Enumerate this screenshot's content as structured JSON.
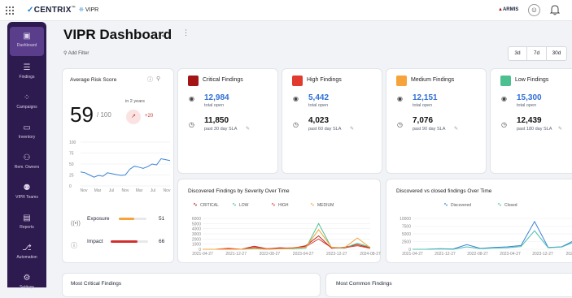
{
  "app": {
    "brand": "CENTRIX",
    "product": "VIPR",
    "partner_logo": "ARMIS"
  },
  "sidebar": {
    "items": [
      {
        "label": "Dashboard",
        "icon": "dashboard-icon",
        "active": true
      },
      {
        "label": "Findings",
        "icon": "list-icon"
      },
      {
        "label": "Campaigns",
        "icon": "campaigns-icon"
      },
      {
        "label": "Inventory",
        "icon": "monitor-icon"
      },
      {
        "label": "Rem. Owners",
        "icon": "users-icon"
      },
      {
        "label": "VIPR Teams",
        "icon": "teams-icon"
      },
      {
        "label": "Reports",
        "icon": "report-icon"
      },
      {
        "label": "Automation",
        "icon": "automation-icon"
      },
      {
        "label": "Settings",
        "icon": "settings-icon"
      }
    ]
  },
  "header": {
    "title": "VIPR Dashboard",
    "add_filter": "Add Filter",
    "ranges": [
      "3d",
      "7d",
      "30d"
    ]
  },
  "risk": {
    "title": "Average Risk Score",
    "score": "59",
    "max": "/ 100",
    "period": "in 2 years",
    "change": "+20",
    "y_ticks": [
      "100",
      "75",
      "50",
      "25",
      "0"
    ],
    "x_ticks": [
      "Nov",
      "Mar",
      "Jul",
      "Nov",
      "Mar",
      "Jul",
      "Nov"
    ],
    "exposure_label": "Exposure",
    "exposure_value": "51",
    "exposure_fraction": 0.55,
    "impact_label": "Impact",
    "impact_value": "66",
    "impact_fraction": 0.72,
    "chart_data": {
      "type": "line",
      "ylim": [
        0,
        100
      ],
      "values": [
        32,
        30,
        25,
        20,
        24,
        22,
        30,
        28,
        26,
        24,
        25,
        38,
        45,
        43,
        40,
        44,
        50,
        48,
        62,
        60,
        58
      ]
    }
  },
  "findings": [
    {
      "title": "Critical Findings",
      "color": "#a31515",
      "total": "12,984",
      "total_label": "total open",
      "past": "11,850",
      "past_label": "past 30 day SLA"
    },
    {
      "title": "High Findings",
      "color": "#e03b2e",
      "total": "5,442",
      "total_label": "total open",
      "past": "4,023",
      "past_label": "past 60 day SLA"
    },
    {
      "title": "Medium Findings",
      "color": "#f5a33a",
      "total": "12,151",
      "total_label": "total open",
      "past": "7,076",
      "past_label": "past 90 day SLA"
    },
    {
      "title": "Low Findings",
      "color": "#4cc08f",
      "total": "15,300",
      "total_label": "total open",
      "past": "12,439",
      "past_label": "past 180 day SLA"
    }
  ],
  "severity_chart": {
    "title": "Discovered Findings by Severity Over Time",
    "legend": [
      "CRITICAL",
      "LOW",
      "HIGH",
      "MEDIUM"
    ],
    "y_ticks": [
      "6000",
      "5000",
      "4000",
      "3000",
      "2000",
      "1000",
      "0"
    ],
    "x_ticks": [
      "2021-04-27",
      "2021-12-27",
      "2022-08-27",
      "2023-04-27",
      "2023-12-27",
      "2024-08-27"
    ],
    "chart_data": {
      "type": "line",
      "ylim": [
        0,
        6000
      ],
      "x": [
        "2021-04-27",
        "2021-08-27",
        "2021-12-27",
        "2022-04-27",
        "2022-08-27",
        "2022-12-27",
        "2023-04-27",
        "2023-08-27",
        "2023-12-27",
        "2024-02-27",
        "2024-04-27",
        "2024-06-27",
        "2024-08-27",
        "2024-10-27"
      ],
      "series": [
        {
          "name": "CRITICAL",
          "color": "#b3261e",
          "values": [
            0,
            0,
            100,
            0,
            600,
            100,
            300,
            200,
            700,
            2600,
            200,
            400,
            900,
            300
          ]
        },
        {
          "name": "LOW",
          "color": "#4cc08f",
          "values": [
            0,
            0,
            0,
            0,
            100,
            0,
            100,
            100,
            200,
            5000,
            300,
            200,
            1200,
            400
          ]
        },
        {
          "name": "HIGH",
          "color": "#e03b2e",
          "values": [
            0,
            0,
            200,
            0,
            400,
            100,
            200,
            300,
            500,
            2000,
            300,
            300,
            700,
            200
          ]
        },
        {
          "name": "MEDIUM",
          "color": "#f5a33a",
          "values": [
            0,
            0,
            0,
            0,
            200,
            0,
            100,
            200,
            400,
            3800,
            400,
            300,
            2200,
            300
          ]
        }
      ]
    }
  },
  "closed_chart": {
    "title": "Discovered vs closed findings Over Time",
    "legend": [
      "Discovered",
      "Closed"
    ],
    "y_ticks": [
      "10000",
      "7500",
      "5000",
      "2500",
      "0"
    ],
    "x_ticks": [
      "2021-04-27",
      "2021-12-27",
      "2022-08-27",
      "2023-04-27",
      "2023-12-27",
      "2024-08-2"
    ],
    "chart_data": {
      "type": "line",
      "ylim": [
        0,
        10000
      ],
      "x": [
        "2021-04-27",
        "2021-08-27",
        "2021-12-27",
        "2022-04-27",
        "2022-08-27",
        "2022-12-27",
        "2023-04-27",
        "2023-08-27",
        "2023-12-27",
        "2024-02-27",
        "2024-04-27",
        "2024-06-27",
        "2024-08-27"
      ],
      "series": [
        {
          "name": "Discovered",
          "color": "#3b82d6",
          "values": [
            0,
            0,
            200,
            100,
            1500,
            300,
            600,
            800,
            1200,
            9000,
            600,
            800,
            3000
          ]
        },
        {
          "name": "Closed",
          "color": "#4cc0b0",
          "values": [
            0,
            0,
            100,
            0,
            800,
            200,
            400,
            500,
            900,
            6000,
            500,
            700,
            2500
          ]
        }
      ]
    }
  },
  "bottom": {
    "most_critical": "Most Critical Findings",
    "most_common": "Most Common Findings"
  }
}
